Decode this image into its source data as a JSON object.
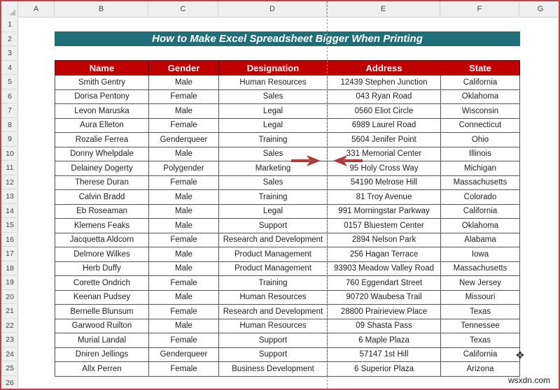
{
  "spreadsheet": {
    "columns": [
      "A",
      "B",
      "C",
      "D",
      "E",
      "F",
      "G"
    ],
    "rows": [
      "1",
      "2",
      "3",
      "4",
      "5",
      "6",
      "7",
      "8",
      "9",
      "10",
      "11",
      "12",
      "13",
      "14",
      "15",
      "16",
      "17",
      "18",
      "19",
      "20",
      "21",
      "22",
      "23",
      "24",
      "25",
      "26"
    ]
  },
  "title": "How to Make Excel Spreadsheet Bigger When Printing",
  "table": {
    "headers": [
      "Name",
      "Gender",
      "Designation",
      "Address",
      "State"
    ],
    "rows": [
      [
        "Smith Gentry",
        "Male",
        "Human Resources",
        "12439 Stephen Junction",
        "California"
      ],
      [
        "Dorisa Pentony",
        "Female",
        "Sales",
        "043 Ryan Road",
        "Oklahoma"
      ],
      [
        "Levon Maruska",
        "Male",
        "Legal",
        "0560 Eliot Circle",
        "Wisconsin"
      ],
      [
        "Aura Elleton",
        "Female",
        "Legal",
        "6989 Laurel Road",
        "Connecticut"
      ],
      [
        "Rozalie Ferrea",
        "Genderqueer",
        "Training",
        "5604 Jenifer Point",
        "Ohio"
      ],
      [
        "Donny Whelpdale",
        "Male",
        "Sales",
        "331 Memorial Center",
        "Illinois"
      ],
      [
        "Delainey Dogerty",
        "Polygender",
        "Marketing",
        "95 Holy Cross Way",
        "Michigan"
      ],
      [
        "Therese Duran",
        "Female",
        "Sales",
        "54190 Melrose Hill",
        "Massachusetts"
      ],
      [
        "Calvin Bradd",
        "Male",
        "Training",
        "81 Troy Avenue",
        "Colorado"
      ],
      [
        "Eb Roseaman",
        "Male",
        "Legal",
        "991 Morningstar Parkway",
        "California"
      ],
      [
        "Klemens Feaks",
        "Male",
        "Support",
        "0157 Bluestem Center",
        "Oklahoma"
      ],
      [
        "Jacquetta Aldcorn",
        "Female",
        "Research and Development",
        "2894 Nelson Park",
        "Alabama"
      ],
      [
        "Delmore Wilkes",
        "Male",
        "Product Management",
        "256 Hagan Terrace",
        "Iowa"
      ],
      [
        "Herb Duffy",
        "Male",
        "Product Management",
        "93903 Meadow Valley Road",
        "Massachusetts"
      ],
      [
        "Corette Ondrich",
        "Female",
        "Training",
        "760 Eggendart Street",
        "New Jersey"
      ],
      [
        "Keenan Pudsey",
        "Male",
        "Human Resources",
        "90720 Waubesa Trail",
        "Missouri"
      ],
      [
        "Bernelle Blunsum",
        "Female",
        "Research and Development",
        "28800 Prairieview Place",
        "Texas"
      ],
      [
        "Garwood Ruilton",
        "Male",
        "Human Resources",
        "09 Shasta Pass",
        "Tennessee"
      ],
      [
        "Murial Landal",
        "Female",
        "Support",
        "6 Maple Plaza",
        "Texas"
      ],
      [
        "Dniren Jellings",
        "Genderqueer",
        "Support",
        "57147 1st Hill",
        "California"
      ],
      [
        "Allx Perren",
        "Female",
        "Business Development",
        "6 Superior Plaza",
        "Arizona"
      ]
    ]
  },
  "colors": {
    "title_bg": "#1f6e7a",
    "header_bg": "#c00000",
    "arrow": "#b03a3a",
    "frame": "#b7474a"
  },
  "icons": {
    "arrow_right": "arrow-right-icon",
    "arrow_left": "arrow-left-icon",
    "cursor": "move-cursor-icon"
  },
  "watermark": "wsxdn.com"
}
